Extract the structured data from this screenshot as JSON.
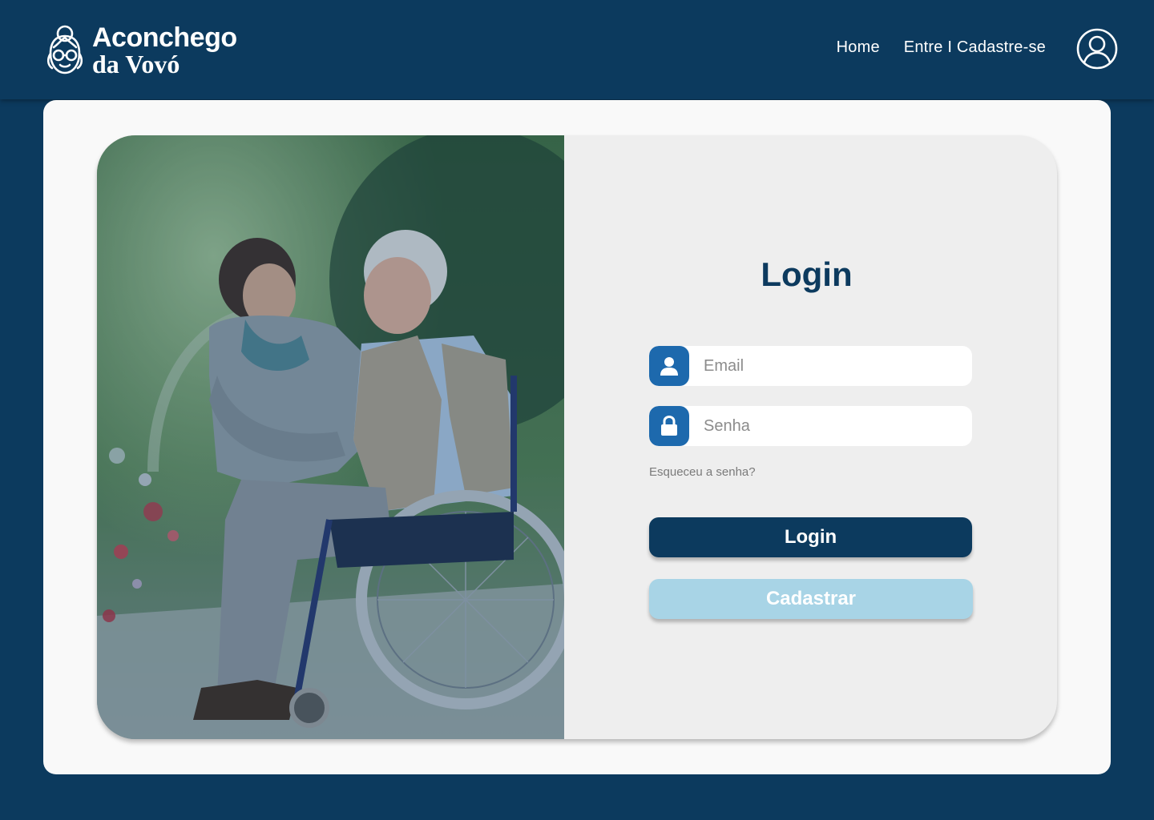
{
  "brand": {
    "line1": "Aconchego",
    "line2": "da Vovó"
  },
  "nav": {
    "home": "Home",
    "auth": "Entre I Cadastre-se"
  },
  "login": {
    "title": "Login",
    "email_placeholder": "Email",
    "password_placeholder": "Senha",
    "forgot": "Esqueceu a senha?",
    "login_button": "Login",
    "register_button": "Cadastrar"
  },
  "icons": {
    "logo": "grandma-logo-icon",
    "user": "user-circle-icon",
    "email": "person-icon",
    "password": "lock-icon"
  },
  "colors": {
    "primary": "#0c3a5e",
    "accent": "#1d69ad",
    "secondary_button": "#a8d4e6",
    "panel": "#eeeeee"
  }
}
